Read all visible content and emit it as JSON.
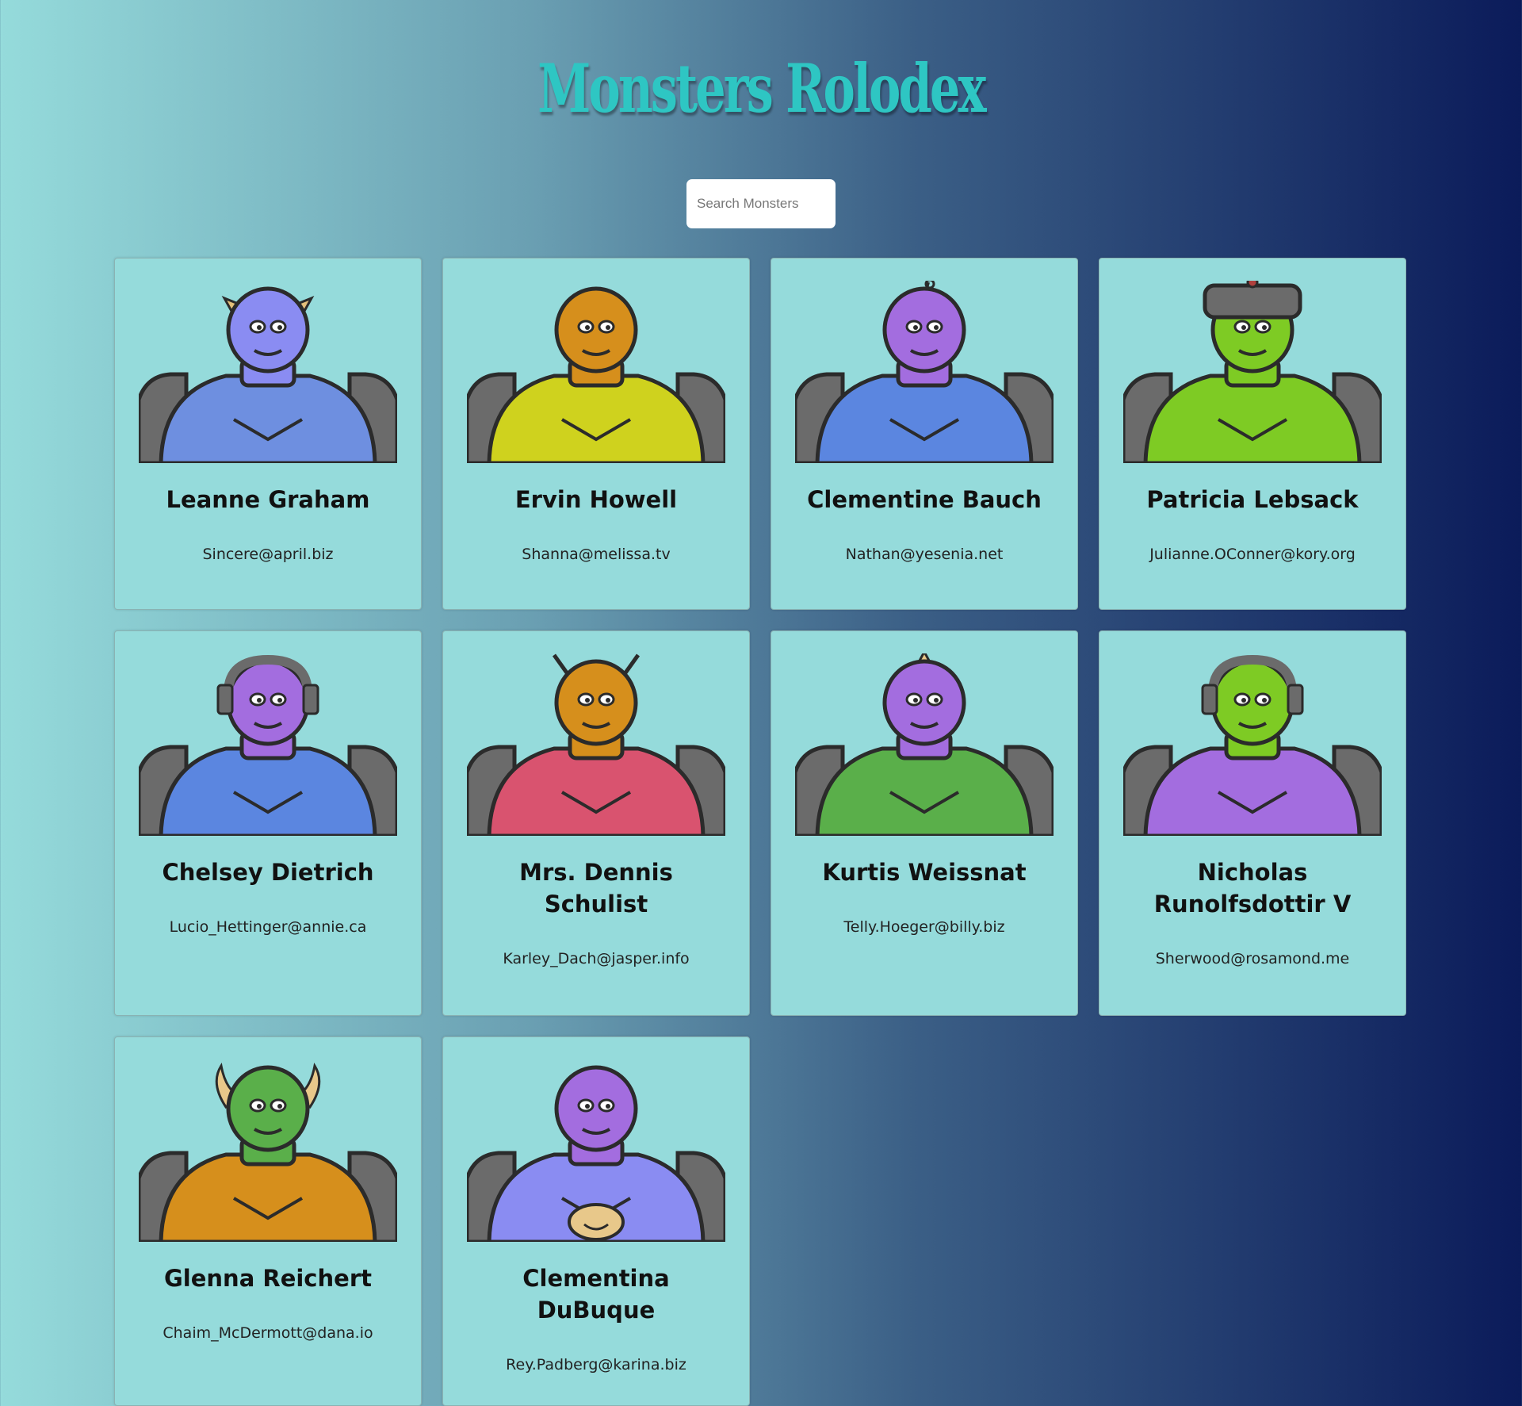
{
  "header": {
    "title": "Monsters Rolodex"
  },
  "search": {
    "placeholder": "Search Monsters"
  },
  "monsters": [
    {
      "name": "Leanne Graham",
      "email": "Sincere@april.biz",
      "head_color": "#8a8cf2",
      "body_color": "#6e8fe0",
      "feature": "horns"
    },
    {
      "name": "Ervin Howell",
      "email": "Shanna@melissa.tv",
      "head_color": "#d68f1c",
      "body_color": "#cfd21e",
      "feature": "plain"
    },
    {
      "name": "Clementine Bauch",
      "email": "Nathan@yesenia.net",
      "head_color": "#a36ddf",
      "body_color": "#5b86e0",
      "feature": "antenna"
    },
    {
      "name": "Patricia Lebsack",
      "email": "Julianne.OConner@kory.org",
      "head_color": "#7ecb24",
      "body_color": "#7ecb24",
      "feature": "helmet"
    },
    {
      "name": "Chelsey Dietrich",
      "email": "Lucio_Hettinger@annie.ca",
      "head_color": "#a36ddf",
      "body_color": "#5b86e0",
      "feature": "headphones"
    },
    {
      "name": "Mrs. Dennis Schulist",
      "email": "Karley_Dach@jasper.info",
      "head_color": "#d68f1c",
      "body_color": "#d9536f",
      "feature": "antennae"
    },
    {
      "name": "Kurtis Weissnat",
      "email": "Telly.Hoeger@billy.biz",
      "head_color": "#a36ddf",
      "body_color": "#5aaf4a",
      "feature": "spike"
    },
    {
      "name": "Nicholas Runolfsdottir V",
      "email": "Sherwood@rosamond.me",
      "head_color": "#7ecb24",
      "body_color": "#a36ddf",
      "feature": "headphones"
    },
    {
      "name": "Glenna Reichert",
      "email": "Chaim_McDermott@dana.io",
      "head_color": "#5aaf4a",
      "body_color": "#d68f1c",
      "feature": "big-horns"
    },
    {
      "name": "Clementina DuBuque",
      "email": "Rey.Padberg@karina.biz",
      "head_color": "#a36ddf",
      "body_color": "#8a8cf2",
      "feature": "smiley"
    }
  ]
}
